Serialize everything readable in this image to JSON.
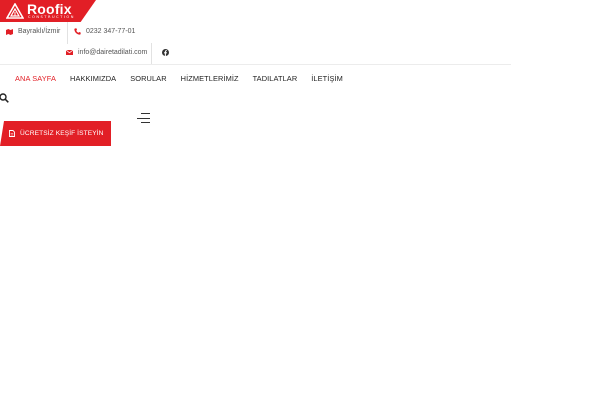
{
  "brand": {
    "name": "Roofix",
    "tagline": "CONSTRUCTION",
    "color": "#e21f26"
  },
  "topbar": {
    "location": {
      "icon": "map-icon",
      "text": "Bayraklı/İzmir"
    },
    "phone": {
      "icon": "phone-icon",
      "text": "0232 347-77-01"
    },
    "email": {
      "icon": "envelope-icon",
      "text": "info@dairetadilati.com"
    },
    "social": [
      {
        "icon": "facebook-icon"
      }
    ]
  },
  "nav": {
    "items": [
      {
        "label": "ANA SAYFA",
        "active": true
      },
      {
        "label": "HAKKIMIZDA",
        "active": false
      },
      {
        "label": "SORULAR",
        "active": false
      },
      {
        "label": "HİZMETLERİMİZ",
        "active": false
      },
      {
        "label": "TADILATLAR",
        "active": false
      },
      {
        "label": "İLETİŞİM",
        "active": false
      }
    ]
  },
  "actions": {
    "search_icon": "search-icon",
    "menu_icon": "hamburger-menu-icon"
  },
  "cta": {
    "icon": "document-icon",
    "label": "ÜCRETSİZ KEŞİF İSTEYİN"
  }
}
